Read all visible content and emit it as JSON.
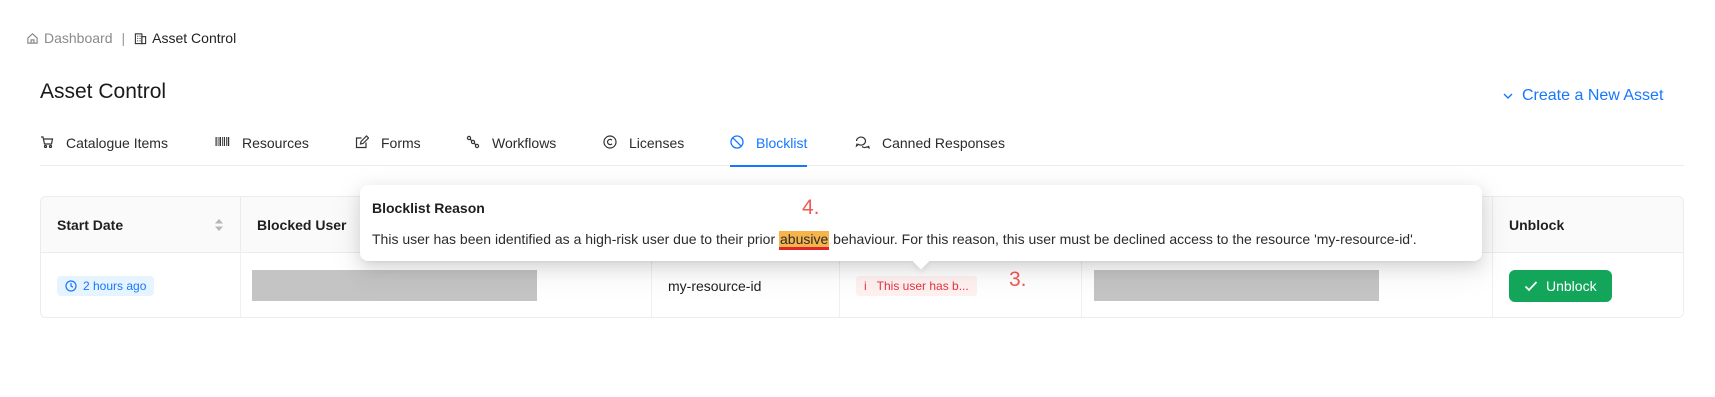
{
  "breadcrumb": {
    "home_label": "Dashboard",
    "home_icon": "home-icon",
    "separator": "|",
    "current_label": "Asset Control",
    "current_icon": "building-icon"
  },
  "page": {
    "title": "Asset Control",
    "create_label": "Create a New Asset",
    "accent_color": "#1677ff"
  },
  "tabs": [
    {
      "label": "Catalogue Items",
      "icon": "cart-icon",
      "active": false
    },
    {
      "label": "Resources",
      "icon": "barcode-icon",
      "active": false
    },
    {
      "label": "Forms",
      "icon": "edit-icon",
      "active": false
    },
    {
      "label": "Workflows",
      "icon": "workflow-icon",
      "active": false
    },
    {
      "label": "Licenses",
      "icon": "copyright-icon",
      "active": false
    },
    {
      "label": "Blocklist",
      "icon": "stop-icon",
      "active": true
    },
    {
      "label": "Canned Responses",
      "icon": "chat-icon",
      "active": false
    }
  ],
  "table": {
    "headers": {
      "start_date": "Start Date",
      "blocked_user": "Blocked User",
      "unblock": "Unblock"
    },
    "row": {
      "start_date": "2 hours ago",
      "resource": "my-resource-id",
      "reason": "This user has b...",
      "unblock_label": "Unblock"
    }
  },
  "popover": {
    "title": "Blocklist Reason",
    "text_before": "This user has been identified as a high-risk user due to their prior ",
    "highlight": "abusive",
    "text_after": " behaviour. For this reason, this user must be declined access to the resource 'my-resource-id'."
  },
  "annotations": {
    "step_3": "3.",
    "step_4": "4."
  },
  "colors": {
    "unblock_button": "#13a65a",
    "reason_tag_text": "#e4343d",
    "highlight_fill": "#f6b44b",
    "highlight_underline": "#e0252b",
    "annotation": "#f05a55"
  }
}
